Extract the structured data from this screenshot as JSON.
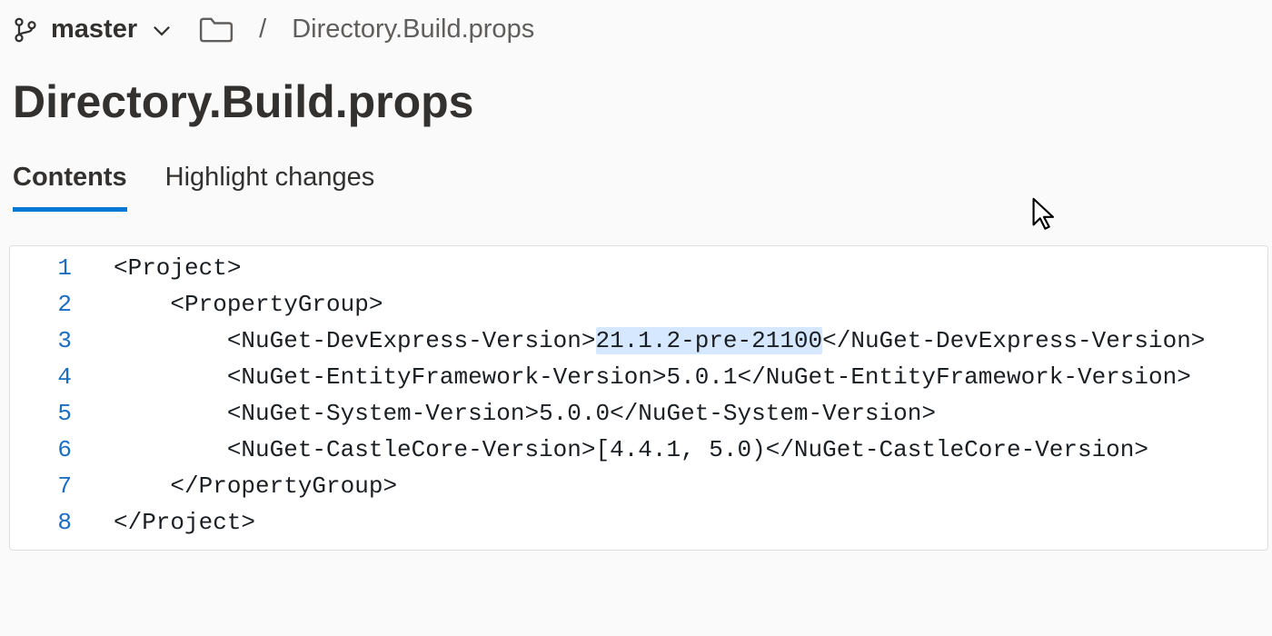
{
  "branch": {
    "name": "master"
  },
  "breadcrumb": {
    "separator": "/",
    "file": "Directory.Build.props"
  },
  "pageTitle": "Directory.Build.props",
  "tabs": {
    "contents": "Contents",
    "highlight": "Highlight changes"
  },
  "code": {
    "line1_num": "1",
    "line1_text": "<Project>",
    "line2_num": "2",
    "line2_text": "    <PropertyGroup>",
    "line3_num": "3",
    "line3_open": "        <NuGet-DevExpress-Version>",
    "line3_val": "21.1.2-pre-21100",
    "line3_close": "</NuGet-DevExpress-Version>",
    "line4_num": "4",
    "line4_text": "        <NuGet-EntityFramework-Version>5.0.1</NuGet-EntityFramework-Version>",
    "line5_num": "5",
    "line5_text": "        <NuGet-System-Version>5.0.0</NuGet-System-Version>",
    "line6_num": "6",
    "line6_text": "        <NuGet-CastleCore-Version>[4.4.1, 5.0)</NuGet-CastleCore-Version>",
    "line7_num": "7",
    "line7_text": "    </PropertyGroup>",
    "line8_num": "8",
    "line8_text": "</Project>"
  }
}
